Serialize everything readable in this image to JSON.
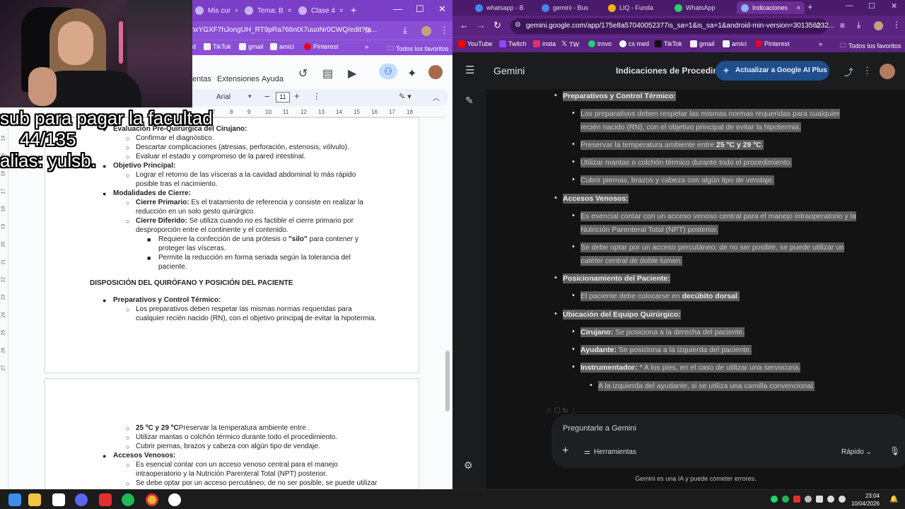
{
  "left_browser": {
    "tabs": [
      "Mis cur",
      "Tema: B",
      "Clase 4"
    ],
    "url": "nxYGXF7hJongUH_RT9pRa766ntX7uuoNr0CWQ/edit?ta...",
    "bookmarks": [
      "d",
      "TikTok",
      "gmail",
      "amici",
      "Pinterest"
    ],
    "bookmarks_folder": "Todos los favoritos"
  },
  "docs": {
    "menu": [
      "entas",
      "Extensiones",
      "Ayuda"
    ],
    "font": "Arial",
    "font_size": "11",
    "ruler": [
      "7",
      "8",
      "9",
      "10",
      "11",
      "12",
      "13",
      "14",
      "15",
      "16",
      "17",
      "18"
    ],
    "vruler": [
      "14",
      "15",
      "16",
      "17",
      "18",
      "19",
      "20",
      "21",
      "22",
      "23",
      "24",
      "25",
      "26",
      "27"
    ],
    "page1": [
      {
        "t": "Evaluación Pre-Quirúrgica del Cirujano:",
        "style": "bold"
      },
      {
        "t": "Confirmar el diagnóstico."
      },
      {
        "t": "Descartar complicaciones (atresias, perforación, estenosis, vólvulo)."
      },
      {
        "t": "Evaluar el estado y compromiso de la pared intestinal."
      },
      {
        "t": "Objetivo Principal:",
        "style": "bold"
      },
      {
        "t": "Lograr el retorno de las vísceras a la cavidad abdominal lo más rápido"
      },
      {
        "t": "posible tras el nacimiento."
      },
      {
        "t": "Modalidades de Cierre:",
        "style": "bold"
      },
      {
        "b": "Cierre Primario:",
        "t": " Es el tratamiento de referencia y consiste en realizar la"
      },
      {
        "t": "reducción en un solo gesto quirúrgico."
      },
      {
        "b": "Cierre Diferido:",
        "t": " Se utiliza cuando no es factible el cierre primario por"
      },
      {
        "t": "desproporción entre el continente y el contenido."
      },
      {
        "t": "Requiere la confección de una prótesis o ",
        "b2": "\"silo\"",
        "t2": " para contener y"
      },
      {
        "t": "proteger las vísceras."
      },
      {
        "t": "Permite la reducción en forma seriada según la tolerancia del"
      },
      {
        "t": "paciente."
      },
      {
        "t": "DISPOSICIÓN DEL QUIRÓFANO Y POSICIÓN DEL PACIENTE",
        "style": "bold"
      },
      {
        "t": "Preparativos y Control Térmico:",
        "style": "bold"
      },
      {
        "t": "Los preparativos deben respetar las mismas normas requeridas para"
      },
      {
        "t": "cualquier recién nacido (RN), con el objetivo principal de evitar la hipotermia."
      }
    ],
    "page2": [
      {
        "t": "Preservar la temperatura ambiente entre ",
        "b": "25 ºC y 29 ºC",
        "t2": "."
      },
      {
        "t": "Utilizar mantas o colchón térmico durante todo el procedimiento."
      },
      {
        "t": "Cubrir piernas, brazos y cabeza con algún tipo de vendaje."
      },
      {
        "t": "Accesos Venosos:",
        "style": "bold"
      },
      {
        "t": "Es esencial contar con un acceso venoso central para el manejo"
      },
      {
        "t": "intraoperatorio y la Nutrición Parenteral Total (NPT) posterior."
      },
      {
        "t": "Se debe optar por un acceso percutáneo; de no ser posible, se puede utilizar"
      }
    ]
  },
  "overlay": {
    "line1": "sub para pagar la facultad",
    "line2": "44/135",
    "line3": "alias: yulsb."
  },
  "right_browser": {
    "tabs": [
      "whatsapp - B",
      "gemini - Bus",
      "LIQ - Funda",
      "WhatsApp",
      "Indicaciones"
    ],
    "url": "gemini.google.com/app/175e8a57040052377is_sa=1&is_sa=1&android-min-version=301356232...",
    "bookmarks": [
      "YouTube",
      "Twitch",
      "insta",
      "TW",
      "trovo",
      "cs med",
      "TikTok",
      "gmail",
      "amici",
      "Pinterest"
    ],
    "bookmarks_folder": "Todos los favoritos"
  },
  "gemini": {
    "logo": "Gemini",
    "title": "Indicaciones de Procedimien",
    "upgrade": "Actualizar a Google AI Plus",
    "input_placeholder": "Preguntarle a Gemini",
    "tools": "Herramientas",
    "speed": "Rápido",
    "disclaimer": "Gemini es una IA y puede cometer errores.",
    "content": [
      {
        "level": 1,
        "b": "Preparativos y Control Térmico:"
      },
      {
        "level": 2,
        "t": "Los preparativos deben respetar las mismas normas requeridas para cualquier"
      },
      {
        "level": 2,
        "cont": true,
        "t": "recién nacido (RN), con el objetivo principal de evitar la hipotermia."
      },
      {
        "level": 2,
        "t": "Preservar la temperatura ambiente entre ",
        "b": "25 ºC y 29 ºC",
        "t2": "."
      },
      {
        "level": 2,
        "t": "Utilizar mantas o colchón térmico durante todo el procedimiento."
      },
      {
        "level": 2,
        "t": "Cubrir piernas, brazos y cabeza con algún tipo de vendaje."
      },
      {
        "level": 1,
        "b": "Accesos Venosos:"
      },
      {
        "level": 2,
        "t": "Es esencial contar con un acceso venoso central para el manejo intraoperatorio y la"
      },
      {
        "level": 2,
        "cont": true,
        "t": "Nutrición Parenteral Total (NPT) posterior."
      },
      {
        "level": 2,
        "t": "Se debe optar por un acceso percutáneo; de no ser posible, se puede utilizar un"
      },
      {
        "level": 2,
        "cont": true,
        "t": "catéter central de doble lumen."
      },
      {
        "level": 1,
        "b": "Posicionamiento del Paciente:"
      },
      {
        "level": 2,
        "t": "El paciente debe colocarse en ",
        "b": "decúbito dorsal",
        "t2": "."
      },
      {
        "level": 1,
        "b": "Ubicación del Equipo Quirúrgico:"
      },
      {
        "level": 2,
        "b": "Cirujano:",
        "t2": " Se posiciona a la derecha del paciente."
      },
      {
        "level": 2,
        "b": "Ayudante:",
        "t2": " Se posiciona a la izquierda del paciente."
      },
      {
        "level": 2,
        "b": "Instrumentador:",
        "t2": " * A los pies, en el caso de utilizar una servocuna."
      },
      {
        "level": 3,
        "t": "A la izquierda del ayudante, si se utiliza una camilla convencional."
      }
    ]
  },
  "taskbar": {
    "time": "23:04",
    "date": "10/04/2026"
  },
  "colors": {
    "left_chrome": "#8a4fd6",
    "right_chrome": "#5a2480",
    "gemini_bg": "#131314",
    "highlight": "#5d5d5d"
  }
}
